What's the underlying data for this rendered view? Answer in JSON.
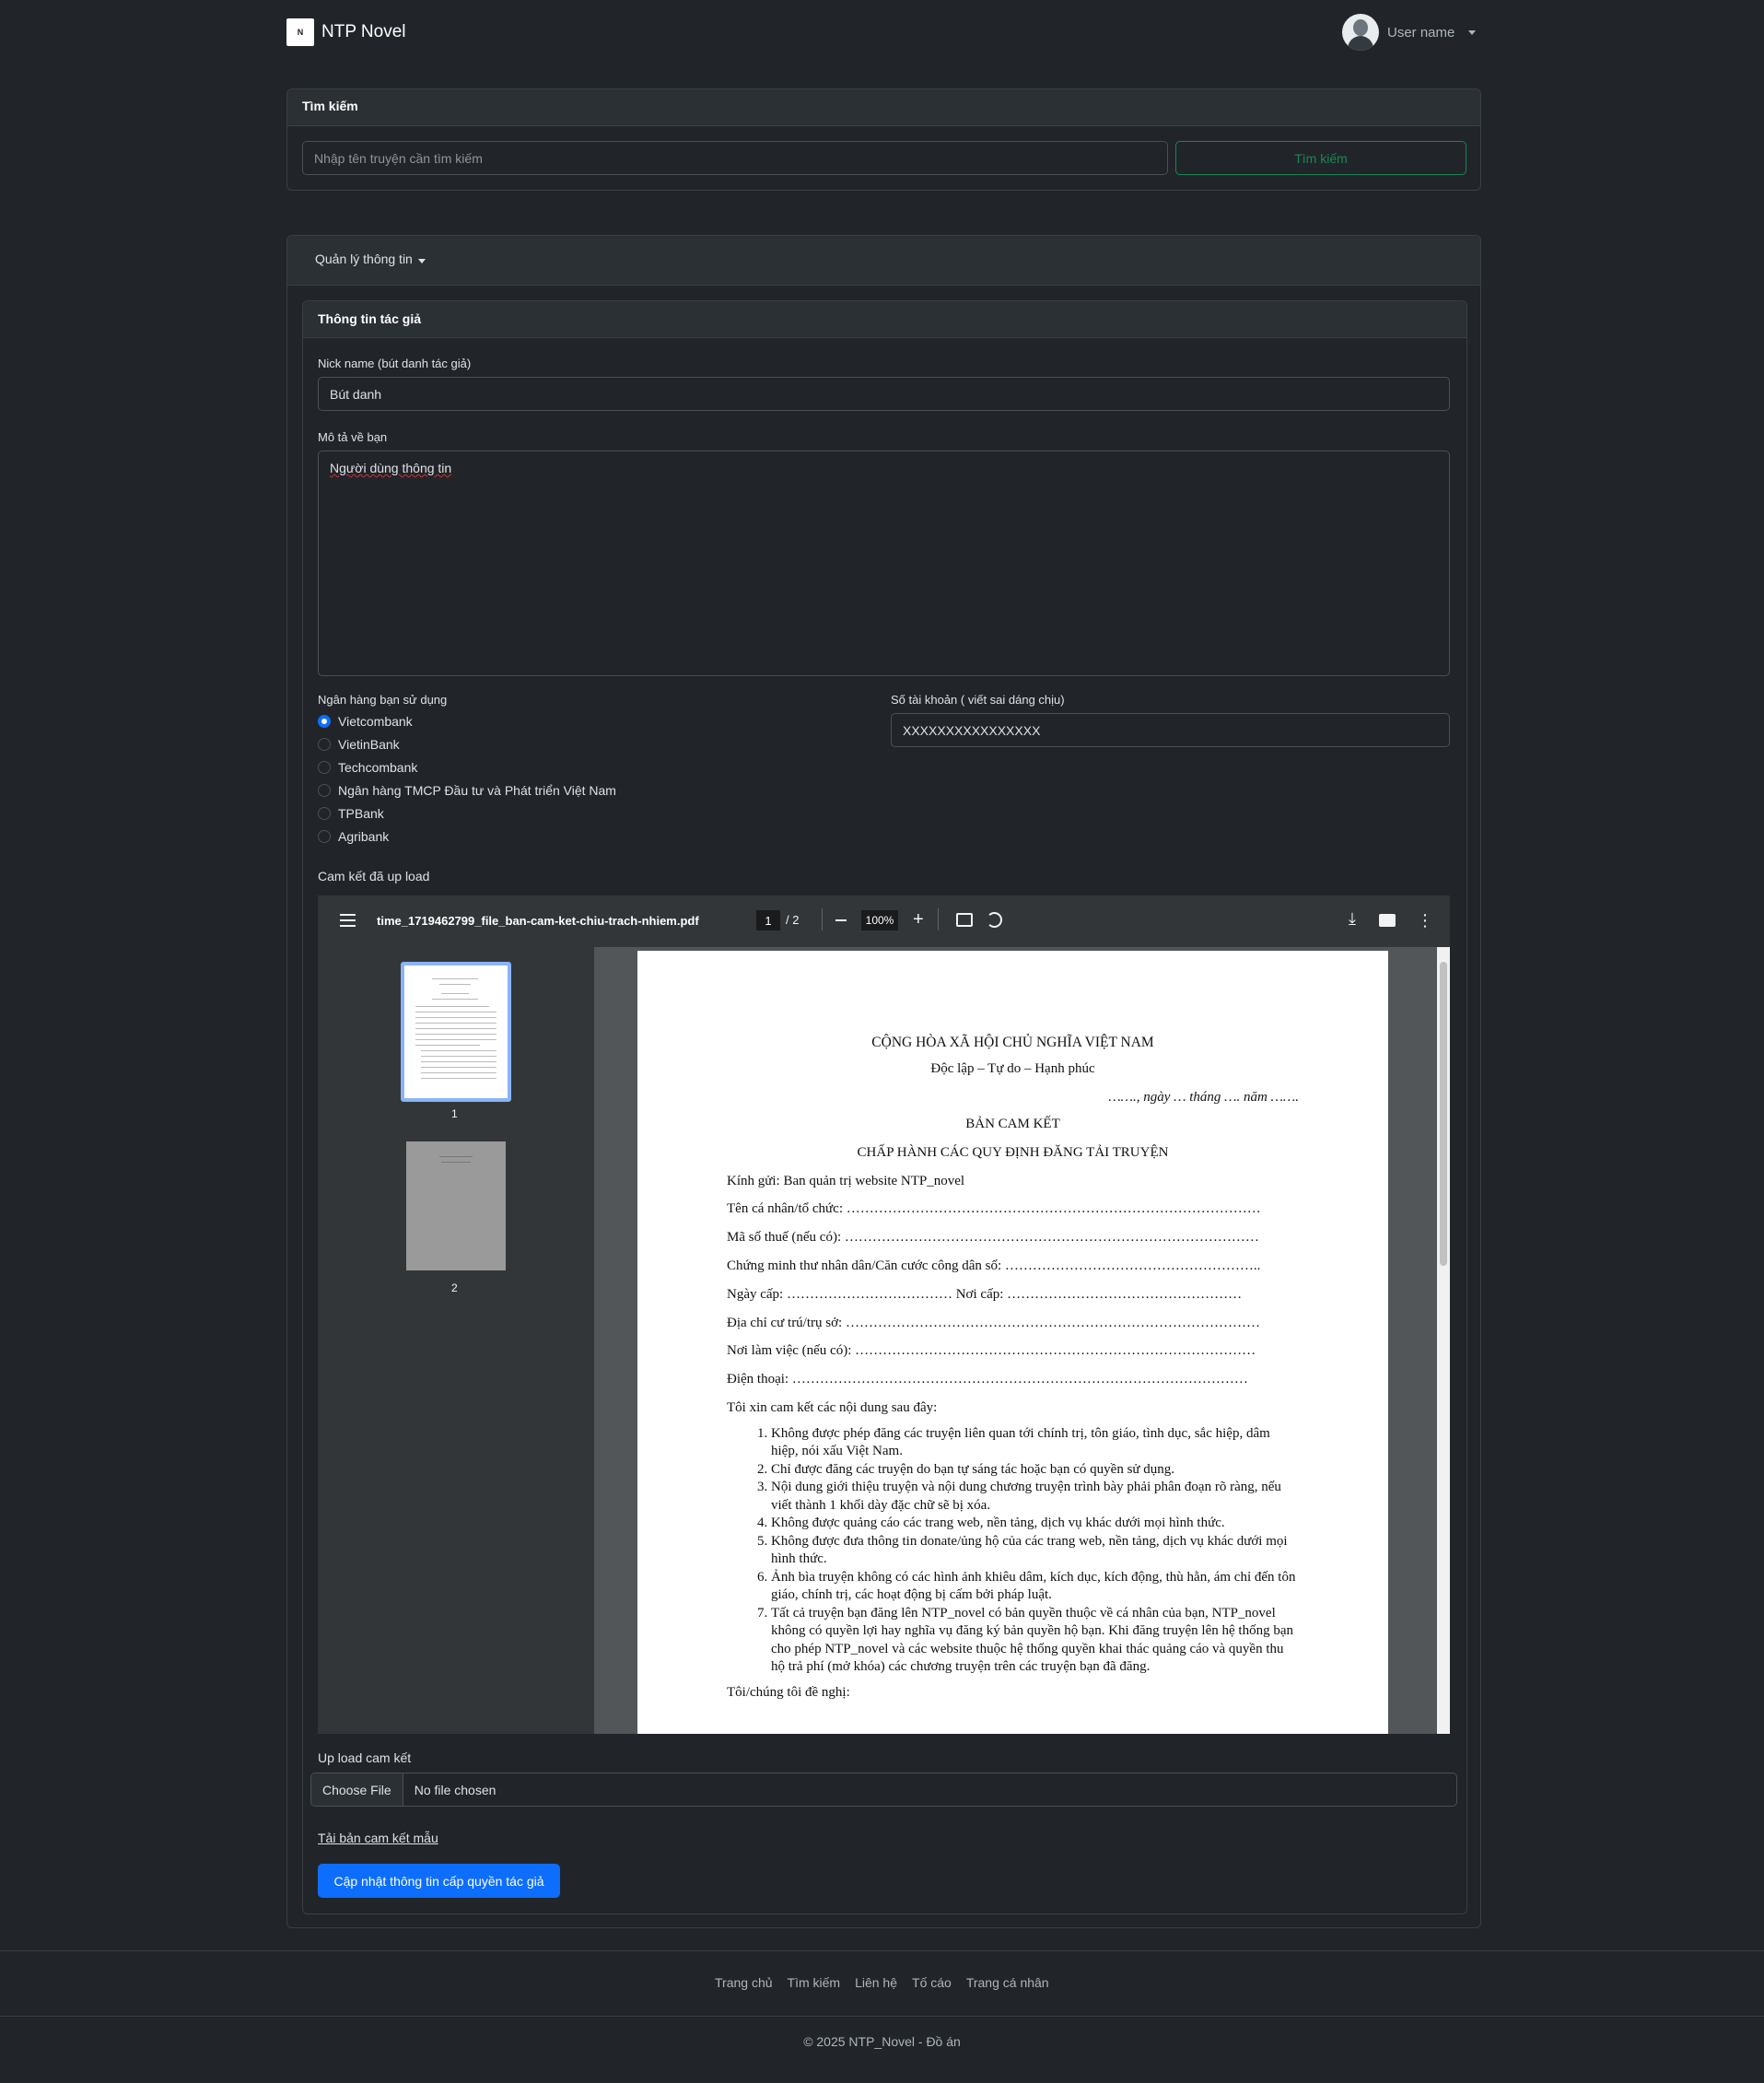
{
  "nav": {
    "brand": "NTP Novel",
    "logo_text": "N",
    "user_name": "User name"
  },
  "search": {
    "title": "Tìm kiếm",
    "placeholder": "Nhập tên truyện cần tìm kiếm",
    "button": "Tìm kiếm"
  },
  "manage": {
    "dropdown": "Quản lý thông tin"
  },
  "author_form": {
    "title": "Thông tin tác giả",
    "nickname_label": "Nick name (bút danh tác giả)",
    "nickname_value": "Bút danh",
    "description_label": "Mô tả về bạn",
    "description_value": "Người dùng thông tin",
    "bank_label": "Ngân hàng bạn sử dụng",
    "banks": [
      {
        "name": "Vietcombank",
        "checked": true
      },
      {
        "name": "VietinBank",
        "checked": false
      },
      {
        "name": "Techcombank",
        "checked": false
      },
      {
        "name": "Ngân hàng TMCP Đầu tư và Phát triển Việt Nam",
        "checked": false
      },
      {
        "name": "TPBank",
        "checked": false
      },
      {
        "name": "Agribank",
        "checked": false
      }
    ],
    "account_label": "Số tài khoản ( viết sai dáng chịu)",
    "account_value": "XXXXXXXXXXXXXXXX",
    "uploaded_label": "Cam kết đã up load",
    "upload_label": "Up load cam kết",
    "choose_file": "Choose File",
    "no_file": "No file chosen",
    "download_sample": "Tải bản cam kết mẫu",
    "submit": "Cập nhật thông tin cấp quyền tác giả"
  },
  "pdf": {
    "filename": "time_1719462799_file_ban-cam-ket-chiu-trach-nhiem.pdf",
    "page_current": "1",
    "page_total": "/ 2",
    "zoom": "100%",
    "thumb_labels": [
      "1",
      "2"
    ],
    "doc": {
      "nation": "CỘNG HÒA XÃ HỘI CHỦ NGHĨA VIỆT NAM",
      "motto": "Độc lập – Tự do – Hạnh phúc",
      "date": "……., ngày … tháng …. năm …….",
      "title1": "BẢN CAM KẾT",
      "title2": "CHẤP HÀNH CÁC QUY ĐỊNH ĐĂNG TẢI TRUYỆN",
      "to": "Kính gửi: Ban quản trị website NTP_novel",
      "fields": [
        "Tên cá nhân/tổ chức: ………………………………………………………………………………",
        "Mã số thuế (nếu có): ………………………………………………………………………………",
        "Chứng minh thư nhân dân/Căn cước công dân số: ………………………………………………..",
        "Ngày cấp: ……………………………… Nơi cấp: ……………………………………………",
        "Địa chỉ cư trú/trụ sở: ………………………………………………………………………………",
        "Nơi làm việc (nếu có): ……………………………………………………………………………",
        "Điện thoại: ………………………………………………………………………………………"
      ],
      "intro": "Tôi xin cam kết các nội dung sau đây:",
      "items": [
        "Không được phép đăng các truyện liên quan tới chính trị, tôn giáo, tình dục, sắc hiệp, dâm hiệp, nói xấu Việt Nam.",
        "Chỉ được đăng các truyện do bạn tự sáng tác hoặc bạn có quyền sử dụng.",
        "Nội dung giới thiệu truyện và nội dung chương truyện trình bày phải phân đoạn rõ ràng, nếu viết thành 1 khối dày đặc chữ sẽ bị xóa.",
        "Không được quảng cáo các trang web, nền tảng, dịch vụ khác dưới mọi hình thức.",
        "Không được đưa thông tin donate/ủng hộ của các trang web, nền tảng, dịch vụ khác dưới mọi hình thức.",
        "Ảnh bìa truyện không có các hình ảnh khiêu dâm, kích dục, kích động, thù hằn, ám chỉ đến tôn giáo, chính trị, các hoạt động bị cấm bởi pháp luật.",
        "Tất cả truyện bạn đăng lên NTP_novel có bản quyền thuộc về cá nhân của bạn, NTP_novel không có quyền lợi hay nghĩa vụ đăng ký bản quyền hộ bạn. Khi đăng truyện lên hệ thống bạn cho phép NTP_novel và các website thuộc hệ thống quyền khai thác quảng cáo và quyền thu hộ trả phí (mở khóa) các chương truyện trên các truyện bạn đã đăng."
      ],
      "closing": "Tôi/chúng tôi đề nghị:"
    }
  },
  "footer": {
    "links": [
      "Trang chủ",
      "Tìm kiếm",
      "Liên hệ",
      "Tố cáo",
      "Trang cá nhân"
    ],
    "copyright": "© 2025 NTP_Novel - Đồ án"
  },
  "colors": {
    "bg": "#212529",
    "primary": "#0d6efd",
    "success": "#198754"
  }
}
